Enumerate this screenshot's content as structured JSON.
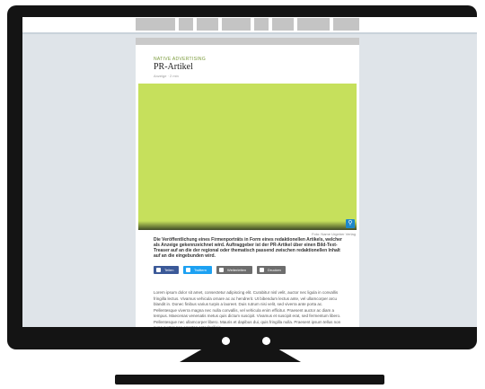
{
  "article": {
    "eyebrow": "NATIVE ADVERTISING",
    "title": "PR-Artikel",
    "meta": "Anzeige · 2 min",
    "caption": "Foto: Name Urgeber Verlag",
    "lead": "Die Veröffentlichung eines Firmenporträts in Form eines redaktionellen Artikels, welcher als Anzeige gekennzeichnet wird. Auftraggeber ist der PR-Artikel über einen Bild-Text-Treaser auf an die der regional oder thematisch passend zwischen redaktionellen Inhalt auf an die eingebunden wird.",
    "lead2": "Text-Treaser auf an die der regional oder thematisch passend zwischen redaktionellen Inhalt auf an die eingebunden wird.",
    "body": "Lorem ipsum dolor sit amet, consectetur adipiscing elit. Curabitur nisl velit, auctor nec ligula in convallis fringilla lectus. Vivamus vehicula ornare ac ac hendrerit. Ut bibendum lectus ante, vel ullamcorper arcu blandit in. Donec finibus varius turpis a laoreet. Duis rutrum nisi velit, sed viverra ante porta ac. Pellentesque viverra magna nec nulla convallis, vel vehicula enim efficitur. Praesent auctor ac diam a tempus. Maecenas venenatis metus quis dictum suscipit. Vivamus et suscipit erat, sed fermentum libero. Pellentesque nec ullamcorper libero. Mauris et dapibus dui, quis fringilla nulla. Praesent ipsum tellus non nunc auctor nec egestas ante facilisis."
  },
  "share": {
    "facebook": "Teilen",
    "twitter": "Twittern",
    "email": "Weiterleiten",
    "print": "Drucken"
  },
  "icons": {
    "zoom": "magnifier-icon"
  },
  "colors": {
    "hero": "#c6e05c",
    "facebook": "#3b5998",
    "twitter": "#1da1f2",
    "email": "#6d6d6d",
    "print": "#6d6d6d"
  }
}
